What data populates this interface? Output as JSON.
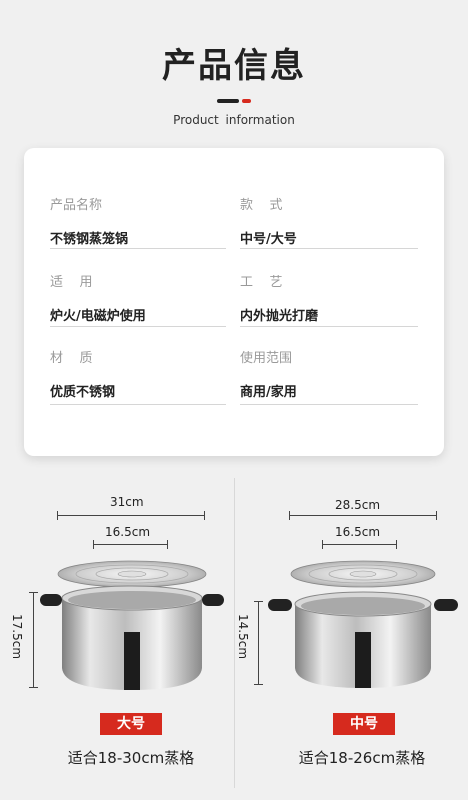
{
  "header": {
    "title": "产品信息",
    "subtitle": "Product  information"
  },
  "info": [
    {
      "label": "产品名称",
      "value": "不锈钢蒸笼锅"
    },
    {
      "label": "款    式",
      "value": "中号/大号"
    },
    {
      "label": "适    用",
      "value": "炉火/电磁炉使用"
    },
    {
      "label": "工    艺",
      "value": "内外抛光打磨"
    },
    {
      "label": "材    质",
      "value": "优质不锈钢"
    },
    {
      "label": "使用范围",
      "value": "商用/家用"
    }
  ],
  "sizes": {
    "large": {
      "outer_width": "31cm",
      "inner_width": "16.5cm",
      "height": "17.5cm",
      "badge": "大号",
      "fit": "适合18-30cm蒸格"
    },
    "medium": {
      "outer_width": "28.5cm",
      "inner_width": "16.5cm",
      "height": "14.5cm",
      "badge": "中号",
      "fit": "适合18-26cm蒸格"
    }
  },
  "colors": {
    "accent": "#d62a1e",
    "background": "#f0f0f0",
    "card": "#ffffff"
  }
}
